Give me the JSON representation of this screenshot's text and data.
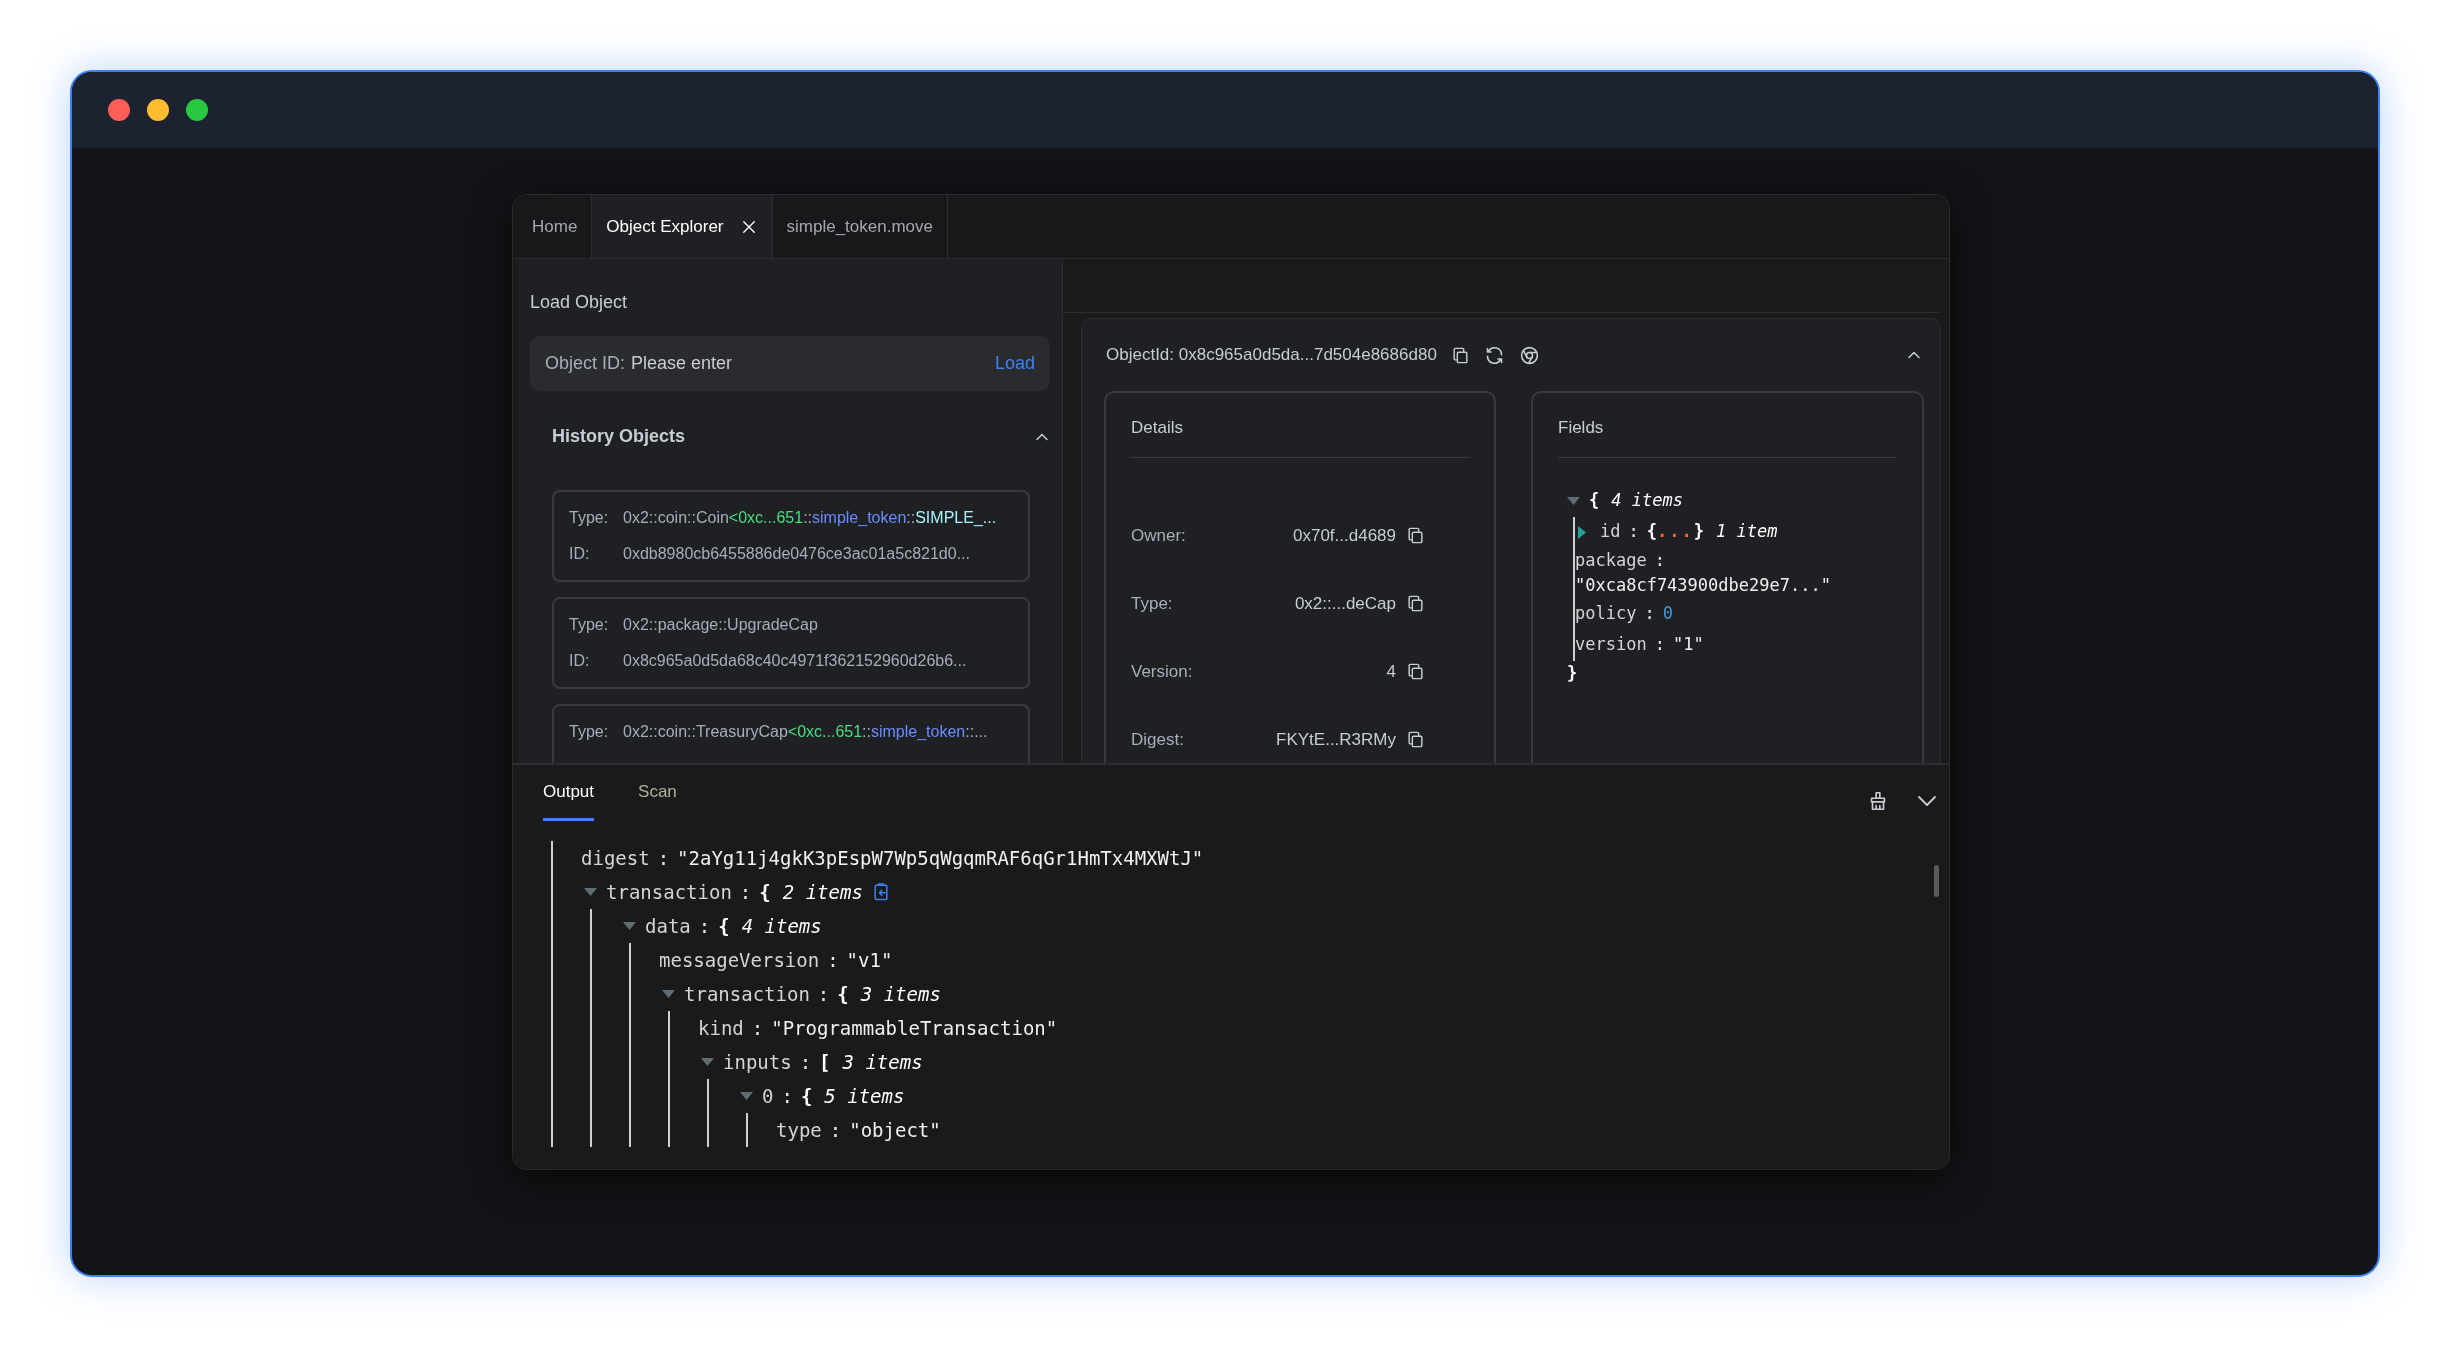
{
  "tabs": [
    {
      "label": "Home",
      "selected": false
    },
    {
      "label": "Object Explorer",
      "selected": true
    },
    {
      "label": "simple_token.move",
      "selected": false
    }
  ],
  "load_object": {
    "title": "Load Object",
    "field": {
      "label": "Object ID:",
      "placeholder": "Please enter"
    },
    "button": "Load"
  },
  "history": {
    "title": "History Objects",
    "expanded": true,
    "items": [
      {
        "type_label": "Type:",
        "type_segments": [
          {
            "text": "0x2::coin::Coin",
            "kind": "plain"
          },
          {
            "text": "<0xc...651",
            "kind": "address"
          },
          {
            "text": "::",
            "kind": "plain"
          },
          {
            "text": "simple_token",
            "kind": "module"
          },
          {
            "text": "::",
            "kind": "plain"
          },
          {
            "text": "SIMPLE_...",
            "kind": "struct"
          }
        ],
        "id_label": "ID:",
        "id": "0xdb8980cb6455886de0476ce3ac01a5c821d0..."
      },
      {
        "type_label": "Type:",
        "type_segments": [
          {
            "text": "0x2::package::UpgradeCap",
            "kind": "plain"
          }
        ],
        "id_label": "ID:",
        "id": "0x8c965a0d5da68c40c4971f362152960d26b6..."
      },
      {
        "type_label": "Type:",
        "type_segments": [
          {
            "text": "0x2::coin::TreasuryCap",
            "kind": "plain"
          },
          {
            "text": "<0xc...651",
            "kind": "address"
          },
          {
            "text": "::",
            "kind": "plain"
          },
          {
            "text": "simple_token",
            "kind": "module"
          },
          {
            "text": "::...",
            "kind": "plain"
          }
        ]
      }
    ]
  },
  "object": {
    "header": "ObjectId: 0x8c965a0d5da...7d504e8686d80",
    "expanded": true,
    "details": {
      "title": "Details",
      "rows": [
        {
          "label": "Owner:",
          "value": "0x70f...d4689"
        },
        {
          "label": "Type:",
          "value": "0x2::...deCap"
        },
        {
          "label": "Version:",
          "value": "4"
        },
        {
          "label": "Digest:",
          "value": "FKYtE...R3RMy"
        }
      ]
    },
    "fields": {
      "title": "Fields",
      "tree": [
        {
          "kind": "object",
          "bracket": "{",
          "count": "4 items",
          "expanded": true,
          "close": "}",
          "children": [
            {
              "kind": "object",
              "key": "id",
              "sep": ":",
              "bracket": "{",
              "ellipsis": "...",
              "close": "}",
              "count": "1 item",
              "expanded": false
            },
            {
              "kind": "string",
              "key": "package",
              "sep": ":",
              "value": "\"0xca8cf743900dbe29e7...\""
            },
            {
              "kind": "number",
              "key": "policy",
              "sep": ":",
              "value": "0"
            },
            {
              "kind": "string",
              "key": "version",
              "sep": ":",
              "value": "\"1\""
            }
          ]
        }
      ]
    }
  },
  "output": {
    "tabs": [
      {
        "label": "Output",
        "selected": true
      },
      {
        "label": "Scan",
        "selected": false
      }
    ],
    "tree": [
      {
        "kind": "string",
        "key": "digest",
        "sep": ":",
        "value": "\"2aYg11j4gkK3pEspW7Wp5qWgqmRAF6qGr1HmTx4MXWtJ\""
      },
      {
        "kind": "object",
        "key": "transaction",
        "sep": ":",
        "bracket": "{",
        "count": "2 items",
        "expanded": true,
        "hovered": true,
        "children": [
          {
            "kind": "object",
            "key": "data",
            "sep": ":",
            "bracket": "{",
            "count": "4 items",
            "expanded": true,
            "children": [
              {
                "kind": "string",
                "key": "messageVersion",
                "sep": ":",
                "value": "\"v1\""
              },
              {
                "kind": "object",
                "key": "transaction",
                "sep": ":",
                "bracket": "{",
                "count": "3 items",
                "expanded": true,
                "children": [
                  {
                    "kind": "string",
                    "key": "kind",
                    "sep": ":",
                    "value": "\"ProgrammableTransaction\""
                  },
                  {
                    "kind": "object",
                    "key": "inputs",
                    "sep": ":",
                    "bracket": "[",
                    "count": "3 items",
                    "expanded": true,
                    "children": [
                      {
                        "kind": "object",
                        "key": "0",
                        "sep": ":",
                        "bracket": "{",
                        "count": "5 items",
                        "expanded": true,
                        "children": [
                          {
                            "kind": "string",
                            "key": "type",
                            "sep": ":",
                            "value": "\"object\""
                          }
                        ]
                      }
                    ]
                  }
                ]
              }
            ]
          }
        ]
      }
    ]
  }
}
